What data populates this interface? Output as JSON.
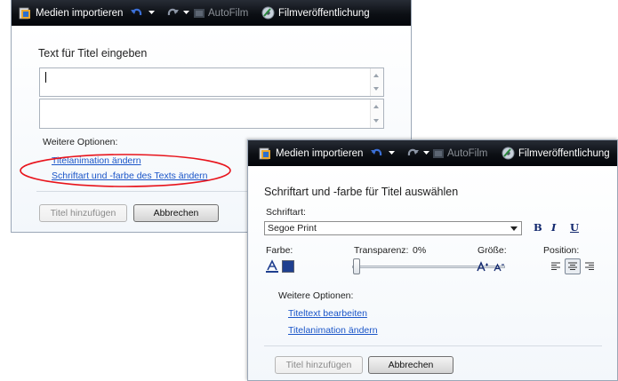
{
  "toolbar": {
    "import_label": "Medien importieren",
    "autofilm_label": "AutoFilm",
    "publish_label": "Filmveröffentlichung"
  },
  "title_dialog": {
    "heading": "Text für Titel eingeben",
    "text_value": "",
    "more_options_label": "Weitere Optionen:",
    "link_animation": "Titelanimation ändern",
    "link_font": "Schriftart und -farbe des Texts ändern",
    "add_title_button": "Titel hinzufügen",
    "cancel_button": "Abbrechen",
    "highlight_color": "#e8141c"
  },
  "font_dialog": {
    "heading": "Schriftart und -farbe für Titel auswählen",
    "font_label": "Schriftart:",
    "font_value": "Segoe Print",
    "bold_label": "B",
    "italic_label": "I",
    "underline_label": "U",
    "color_label": "Farbe:",
    "transparency_label": "Transparenz:",
    "transparency_value": "0%",
    "size_label": "Größe:",
    "position_label": "Position:",
    "size_up_label": "A",
    "size_down_label": "A",
    "more_options_label": "Weitere Optionen:",
    "link_edit_text": "Titeltext bearbeiten",
    "link_animation": "Titelanimation ändern",
    "add_title_button": "Titel hinzufügen",
    "cancel_button": "Abbrechen",
    "selected_alignment": "center"
  },
  "colors": {
    "toolbar_bg": "#0c0f14",
    "link": "#1a55c8",
    "swatch": "#1f3f8f"
  },
  "icons": [
    "import-media-icon",
    "undo-icon",
    "redo-icon",
    "autofilm-icon",
    "publish-icon",
    "text-color-icon",
    "color-swatch-icon",
    "increase-font-icon",
    "decrease-font-icon",
    "align-left-icon",
    "align-center-icon",
    "align-right-icon"
  ]
}
